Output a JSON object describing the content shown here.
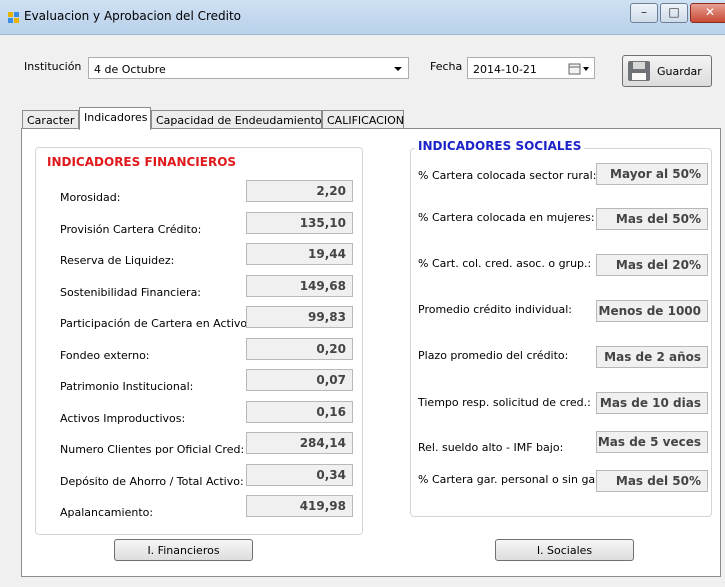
{
  "window": {
    "title": "Evaluacion y Aprobacion del Credito"
  },
  "header": {
    "institucion_label": "Institución",
    "institucion_value": "4 de Octubre",
    "fecha_label": "Fecha",
    "fecha_value": "2014-10-21",
    "guardar_label": "Guardar"
  },
  "tabs": [
    {
      "label": "Caracter"
    },
    {
      "label": "Indicadores"
    },
    {
      "label": "Capacidad de Endeudamiento"
    },
    {
      "label": "CALIFICACION"
    }
  ],
  "active_tab": "Indicadores",
  "financieros": {
    "title": "INDICADORES FINANCIEROS",
    "title_color": "#e0191c",
    "rows": [
      {
        "label": "Morosidad:",
        "value": "2,20"
      },
      {
        "label": "Provisión Cartera Crédito:",
        "value": "135,10"
      },
      {
        "label": "Reserva de Liquidez:",
        "value": "19,44"
      },
      {
        "label": "Sostenibilidad Financiera:",
        "value": "149,68"
      },
      {
        "label": "Participación de Cartera en Activo:",
        "value": "99,83"
      },
      {
        "label": "Fondeo externo:",
        "value": "0,20"
      },
      {
        "label": "Patrimonio Institucional:",
        "value": "0,07"
      },
      {
        "label": "Activos Improductivos:",
        "value": "0,16"
      },
      {
        "label": "Numero Clientes por Oficial Cred:",
        "value": "284,14"
      },
      {
        "label": "Depósito de Ahorro / Total Activo:",
        "value": "0,34"
      },
      {
        "label": "Apalancamiento:",
        "value": "419,98"
      }
    ],
    "button_label": "I. Financieros"
  },
  "sociales": {
    "title": "INDICADORES SOCIALES",
    "title_color": "#1c23c8",
    "rows": [
      {
        "label": "% Cartera colocada sector rural:",
        "value": "Mayor al 50%"
      },
      {
        "label": "% Cartera colocada en mujeres:",
        "value": "Mas del 50%"
      },
      {
        "label": "% Cart. col. cred. asoc. o grup.:",
        "value": "Mas del 20%"
      },
      {
        "label": "Promedio crédito individual:",
        "value": "Menos de 1000"
      },
      {
        "label": "Plazo promedio del crédito:",
        "value": "Mas de 2 años"
      },
      {
        "label": "Tiempo resp. solicitud de cred.:",
        "value": "Mas de 10 dias"
      },
      {
        "label": "Rel. sueldo alto - IMF bajo:",
        "value": "Mas de 5 veces"
      },
      {
        "label": "% Cartera gar. personal o sin gar.:",
        "value": "Mas del 50%"
      }
    ],
    "button_label": "I. Sociales"
  }
}
